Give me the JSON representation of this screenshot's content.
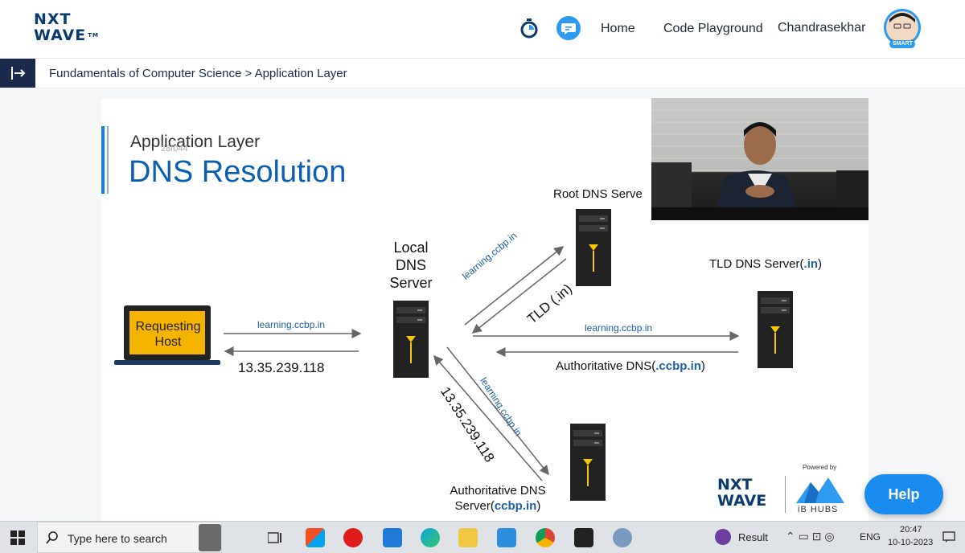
{
  "header": {
    "logo_line1": "NXT",
    "logo_line2": "WAVE",
    "logo_tm": "TM",
    "nav": [
      "Home",
      "Code Playground"
    ],
    "user_name": "Chandrasekhar",
    "avatar_badge": "SMART"
  },
  "breadcrumb": {
    "course": "Fundamentals of Computer Science",
    "separator": ">",
    "page": "Application Layer"
  },
  "slide": {
    "subtitle": "Application Layer",
    "title": "DNS Resolution",
    "watermark": "28f044",
    "requesting_host": [
      "Requesting",
      "Host"
    ],
    "local_dns": [
      "Local",
      "DNS",
      "Server"
    ],
    "root_dns": "Root DNS Serve",
    "tld_dns_prefix": "TLD DNS Server(",
    "tld_dns_bold": ".in",
    "tld_dns_suffix": ")",
    "auth_dns_line1": "Authoritative DNS",
    "auth_dns_line2_prefix": "Server(",
    "auth_dns_line2_bold": "ccbp.in",
    "auth_dns_line2_suffix": ")",
    "auth_dns_mid_prefix": "Authoritative DNS(",
    "auth_dns_mid_bold": ".ccbp.in",
    "auth_dns_mid_suffix": ")",
    "query_label": "learning.ccbp.in",
    "ip_answer": "13.35.239.118",
    "tld_answer": "TLD (.in)",
    "powered_by": "Powered by",
    "brand1_line1": "NXT",
    "brand1_line2": "WAVE",
    "brand2": "iB HUBS"
  },
  "help_label": "Help",
  "taskbar": {
    "search_placeholder": "Type here to search",
    "result_label": "Result",
    "lang": "ENG",
    "time": "20:47",
    "date": "10-10-2023"
  },
  "colors": {
    "brand_navy": "#0b3a6e",
    "accent_blue": "#1a8cf0",
    "slide_title_blue": "#0b5fae",
    "laptop_screen": "#f5b400"
  }
}
